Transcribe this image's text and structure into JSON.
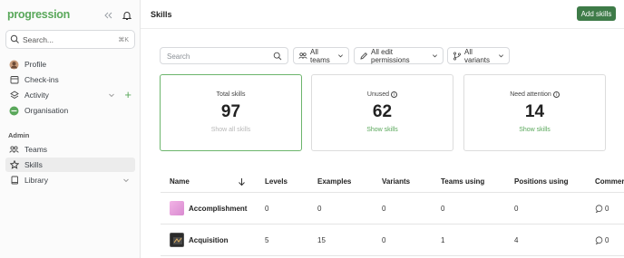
{
  "app": {
    "logo": "progression"
  },
  "sidebar": {
    "search_placeholder": "Search...",
    "search_shortcut": "⌘K",
    "items": [
      {
        "label": "Profile"
      },
      {
        "label": "Check-ins"
      },
      {
        "label": "Activity"
      },
      {
        "label": "Organisation"
      }
    ],
    "admin_label": "Admin",
    "admin_items": [
      {
        "label": "Teams"
      },
      {
        "label": "Skills"
      },
      {
        "label": "Library"
      }
    ]
  },
  "header": {
    "title": "Skills",
    "add_button": "Add skills"
  },
  "filters": {
    "search_placeholder": "Search",
    "teams": "All teams",
    "permissions": "All edit permissions",
    "variants": "All variants"
  },
  "cards": [
    {
      "title": "Total skills",
      "value": "97",
      "link": "Show all skills"
    },
    {
      "title": "Unused",
      "value": "62",
      "link": "Show skills"
    },
    {
      "title": "Need attention",
      "value": "14",
      "link": "Show skills"
    }
  ],
  "table": {
    "headers": [
      "Name",
      "Levels",
      "Examples",
      "Variants",
      "Teams using",
      "Positions using",
      "Commer"
    ],
    "rows": [
      {
        "name": "Accomplishment",
        "levels": "0",
        "examples": "0",
        "variants": "0",
        "teams": "0",
        "positions": "0",
        "comments": "0"
      },
      {
        "name": "Acquisition",
        "levels": "5",
        "examples": "15",
        "variants": "0",
        "teams": "1",
        "positions": "4",
        "comments": "0"
      }
    ]
  },
  "colors": {
    "accent": "#3e7b48",
    "link": "#5aa85b",
    "selected_border": "#6cb56c"
  }
}
